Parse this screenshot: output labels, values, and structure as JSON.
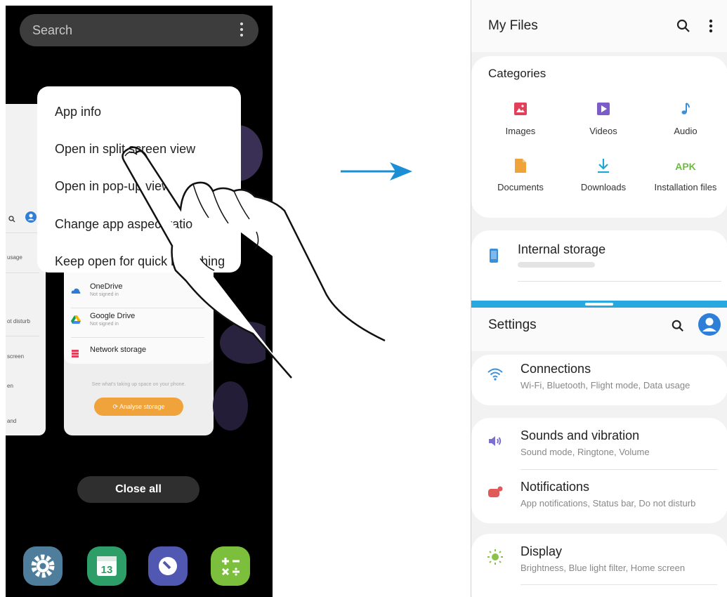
{
  "left_phone": {
    "search": {
      "placeholder": "Search"
    },
    "context_menu": {
      "items": [
        "App info",
        "Open in split screen view",
        "Open in pop-up view",
        "Change app aspect ratio",
        "Keep open for quick launching"
      ]
    },
    "background_card_left": {
      "snippets": [
        "usage",
        "ot disturb",
        "screen",
        "en",
        "and"
      ]
    },
    "background_card_mid": {
      "rows": [
        {
          "name": "OneDrive",
          "sub": "Not signed in"
        },
        {
          "name": "Google Drive",
          "sub": "Not signed in"
        },
        {
          "name": "Network storage",
          "sub": ""
        }
      ],
      "hint": "See what's taking up space on your phone.",
      "analyse_label": "Analyse storage"
    },
    "close_all_label": "Close all",
    "dock": [
      {
        "icon": "settings-gear-icon",
        "color": "#4f7e9d"
      },
      {
        "icon": "calendar-icon",
        "color": "#2e9e68",
        "day": "13"
      },
      {
        "icon": "bixby-icon",
        "color": "#5158b2"
      },
      {
        "icon": "calculator-icon",
        "color": "#7cbf3c"
      }
    ]
  },
  "right_phone": {
    "myfiles": {
      "title": "My Files",
      "categories_title": "Categories",
      "categories": [
        {
          "label": "Images",
          "icon": "images-icon",
          "color": "#e0405a"
        },
        {
          "label": "Videos",
          "icon": "videos-icon",
          "color": "#7b5cc9"
        },
        {
          "label": "Audio",
          "icon": "audio-icon",
          "color": "#3b8fd9"
        },
        {
          "label": "Documents",
          "icon": "documents-icon",
          "color": "#f0a23b"
        },
        {
          "label": "Downloads",
          "icon": "downloads-icon",
          "color": "#1ea7d4"
        },
        {
          "label": "Installation files",
          "icon": "apk-icon",
          "color": "#6bbf3b",
          "glyph": "APK"
        }
      ],
      "internal_storage": "Internal storage"
    },
    "settings": {
      "title": "Settings",
      "items": [
        {
          "title": "Connections",
          "sub": "Wi-Fi, Bluetooth, Flight mode, Data usage",
          "icon": "wifi-icon",
          "color": "#3b8fd9"
        },
        {
          "title": "Sounds and vibration",
          "sub": "Sound mode, Ringtone, Volume",
          "icon": "speaker-icon",
          "color": "#7b6fd0"
        },
        {
          "title": "Notifications",
          "sub": "App notifications, Status bar, Do not disturb",
          "icon": "notifications-icon",
          "color": "#e05a5a"
        },
        {
          "title": "Display",
          "sub": "Brightness, Blue light filter, Home screen",
          "icon": "brightness-icon",
          "color": "#8bc34a"
        }
      ]
    }
  },
  "colors": {
    "accent_blue": "#1a8fd6",
    "divider_bar": "#29a8e0"
  }
}
